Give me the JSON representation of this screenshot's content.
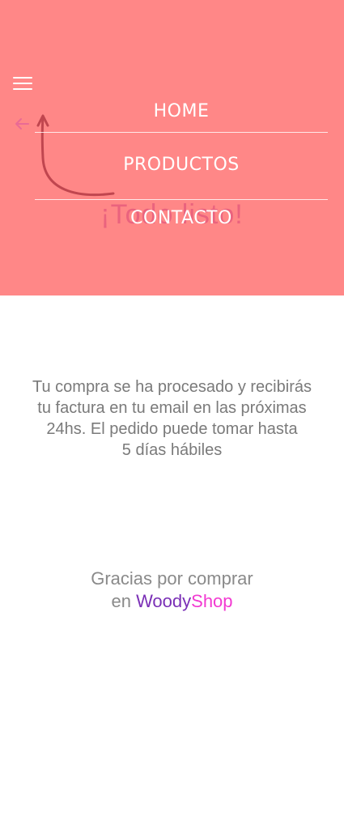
{
  "hero": {
    "background_color": "#ff8787",
    "behind_title": "¡Todo listo!",
    "back_icon": "arrow-left-icon",
    "hand_drawn_arrow": "curved-arrow-up-icon"
  },
  "menu": {
    "toggle_icon": "hamburger-menu-icon",
    "items": [
      {
        "label": "HOME"
      },
      {
        "label": "PRODUCTOS"
      },
      {
        "label": "CONTACTO"
      }
    ]
  },
  "message": {
    "lines": [
      "Tu compra se ha procesado y recibirás",
      "tu factura en tu email en las próximas",
      "24hs. El pedido puede tomar hasta",
      "5 días hábiles"
    ]
  },
  "thanks": {
    "line1": "Gracias por comprar",
    "line2_prefix": "en",
    "brand_part1": "Woody",
    "brand_part2": "Shop",
    "brand_color_1": "#7a2fb6",
    "brand_color_2": "#f23ad1"
  }
}
